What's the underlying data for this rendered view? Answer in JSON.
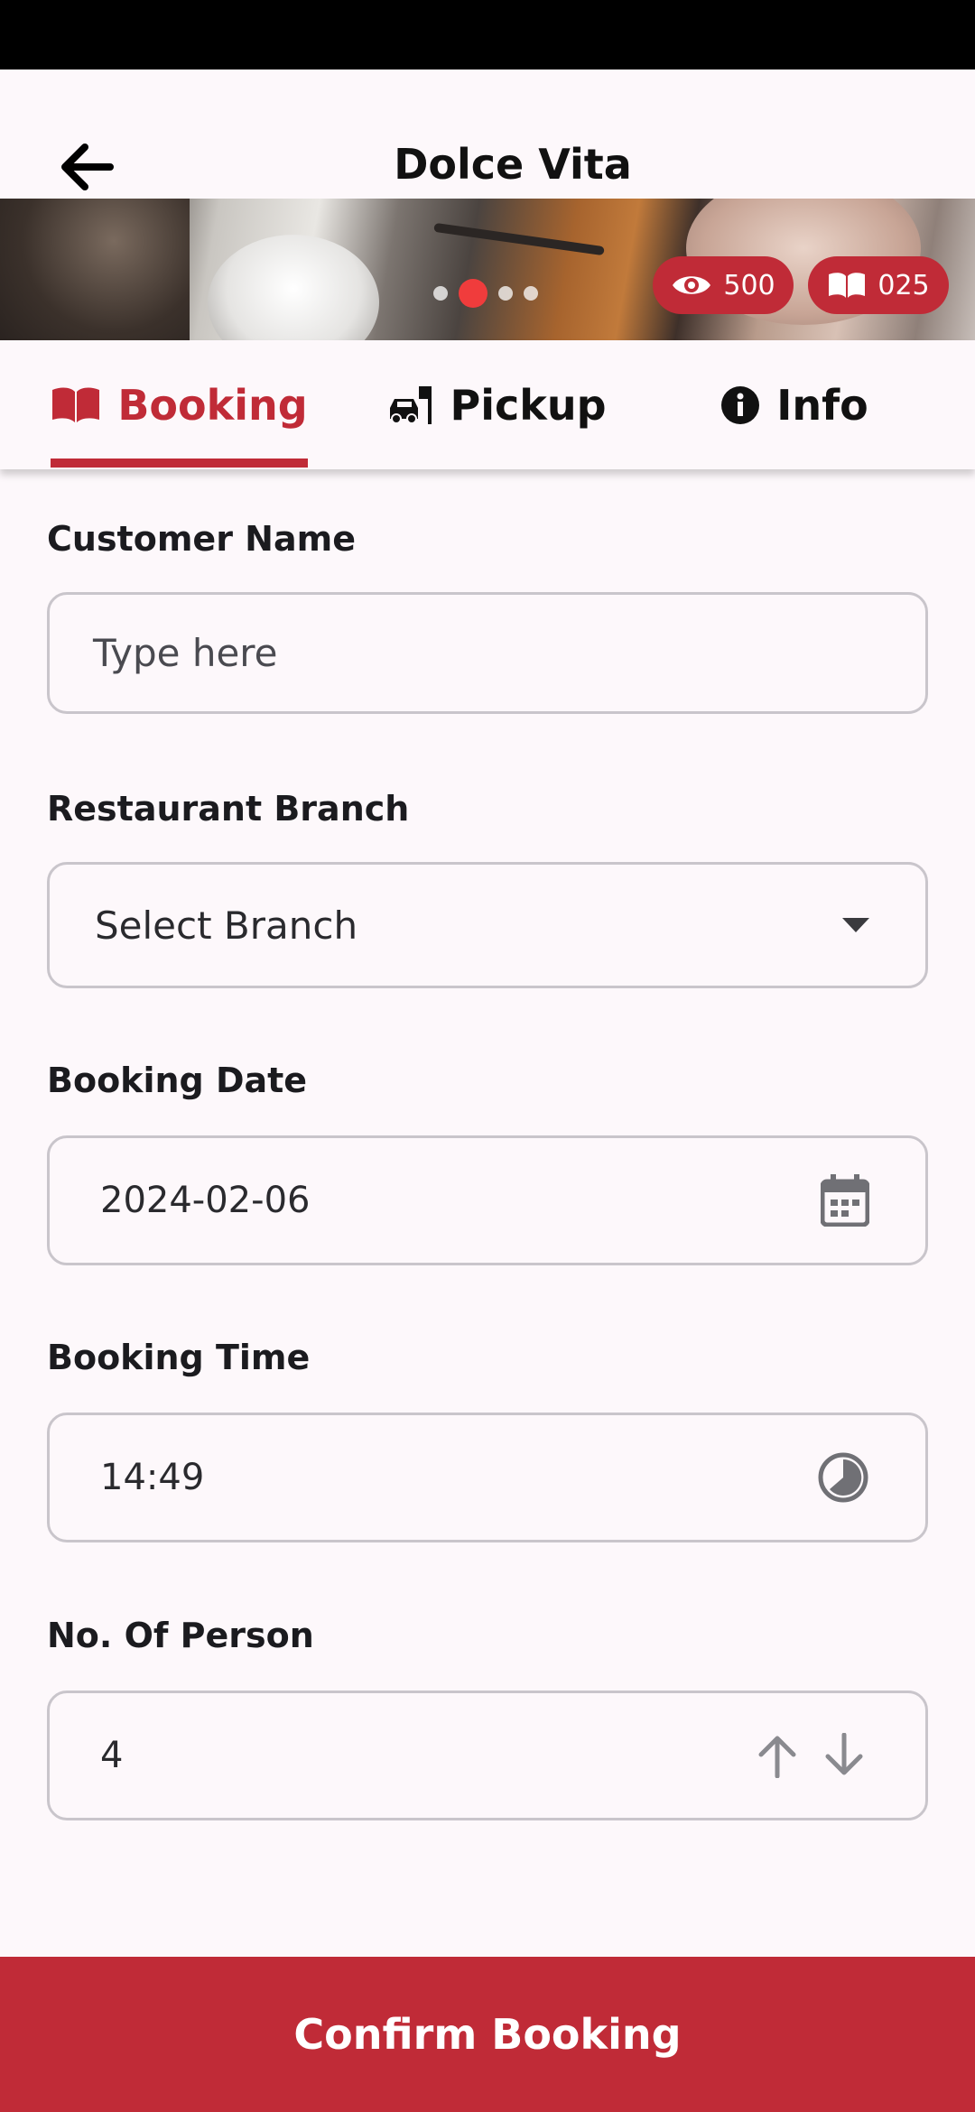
{
  "app_bar": {
    "title": "Dolce Vita"
  },
  "banner": {
    "views_count": "500",
    "bookings_count": "025",
    "carousel": {
      "pages": 4,
      "active_index": 1
    }
  },
  "tabs": [
    {
      "label": "Booking",
      "icon": "book-icon",
      "selected": true
    },
    {
      "label": "Pickup",
      "icon": "car-pickup-icon",
      "selected": false
    },
    {
      "label": "Info",
      "icon": "info-icon",
      "selected": false
    }
  ],
  "form": {
    "customer_name": {
      "label": "Customer Name",
      "placeholder": "Type here",
      "value": ""
    },
    "branch": {
      "label": "Restaurant Branch",
      "value": "Select Branch"
    },
    "date": {
      "label": "Booking Date",
      "value": "2024-02-06"
    },
    "time": {
      "label": "Booking Time",
      "value": "14:49"
    },
    "persons": {
      "label": "No. Of Person",
      "value": "4"
    }
  },
  "confirm_button": {
    "label": "Confirm Booking"
  },
  "colors": {
    "accent": "#c02b37",
    "active_dot": "#f03c3c"
  }
}
